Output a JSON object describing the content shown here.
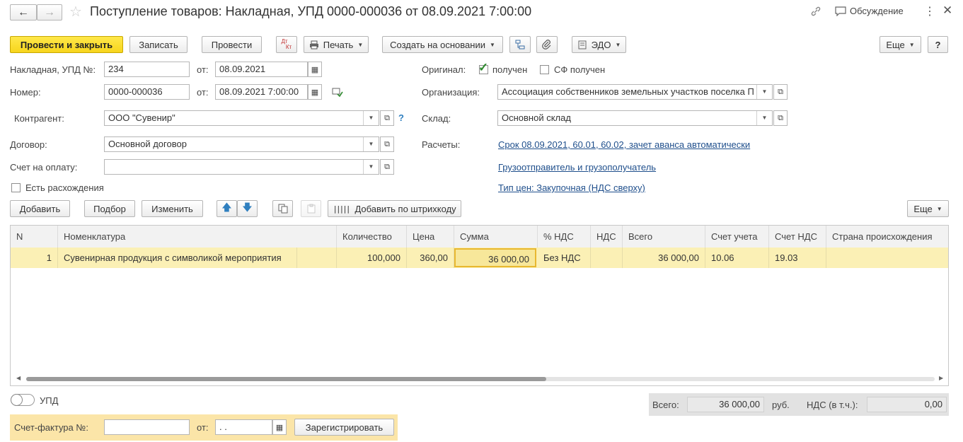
{
  "window": {
    "title": "Поступление товаров: Накладная, УПД 0000-000036 от 08.09.2021 7:00:00",
    "discuss_label": "Обсуждение"
  },
  "toolbar": {
    "post_close": "Провести и закрыть",
    "save": "Записать",
    "post": "Провести",
    "dtkt_top": "Дт",
    "dtkt_bottom": "Кт",
    "print": "Печать",
    "create_based": "Создать на основании",
    "edo": "ЭДО",
    "more": "Еще",
    "help": "?"
  },
  "form": {
    "invoice_label": "Накладная, УПД №:",
    "invoice_value": "234",
    "from_label": "от:",
    "invoice_date": "08.09.2021",
    "number_label": "Номер:",
    "number_value": "0000-000036",
    "number_date": "08.09.2021  7:00:00",
    "contractor_label": "Контрагент:",
    "contractor_value": "ООО \"Сувенир\"",
    "contract_label": "Договор:",
    "contract_value": "Основной договор",
    "pay_account_label": "Счет на оплату:",
    "pay_account_value": "",
    "discrepancy_label": "Есть расхождения",
    "original_label": "Оригинал:",
    "received_label": "получен",
    "sf_received_label": "СФ получен",
    "org_label": "Организация:",
    "org_value": "Ассоциация собственников земельных участков поселка П",
    "warehouse_label": "Склад:",
    "warehouse_value": "Основной склад",
    "settlements_label": "Расчеты:",
    "settlements_link": "Срок 08.09.2021, 60.01, 60.02, зачет аванса автоматически",
    "shipper_link": "Грузоотправитель и грузополучатель",
    "price_type_link": "Тип цен: Закупочная (НДС сверху)"
  },
  "table_toolbar": {
    "add": "Добавить",
    "pick": "Подбор",
    "change": "Изменить",
    "barcode": "Добавить по штрихкоду",
    "more": "Еще"
  },
  "table": {
    "headers": [
      "N",
      "Номенклатура",
      "Количество",
      "Цена",
      "Сумма",
      "% НДС",
      "НДС",
      "Всего",
      "Счет учета",
      "Счет НДС",
      "Страна происхождения"
    ],
    "rows": [
      {
        "n": "1",
        "item": "Сувенирная продукция с символикой мероприятия",
        "qty": "100,000",
        "price": "360,00",
        "sum": "36 000,00",
        "vat_rate": "Без НДС",
        "vat": "",
        "total": "36 000,00",
        "account": "10.06",
        "vat_account": "19.03",
        "country": ""
      }
    ]
  },
  "footer": {
    "upd_label": "УПД",
    "invoice_label": "Счет-фактура №:",
    "invoice_value": "",
    "from_label": "от:",
    "invoice_date": " .  .",
    "register_button": "Зарегистрировать",
    "total_label": "Всего:",
    "total_value": "36 000,00",
    "currency": "руб.",
    "vat_label": "НДС (в т.ч.):",
    "vat_value": "0,00"
  },
  "colors": {
    "accent_yellow": "#f7d51d",
    "selected_row": "#fbf0b5",
    "link": "#1f4f8c",
    "footer_bg": "#fbe5a8",
    "check_green": "#2f8a2f"
  }
}
